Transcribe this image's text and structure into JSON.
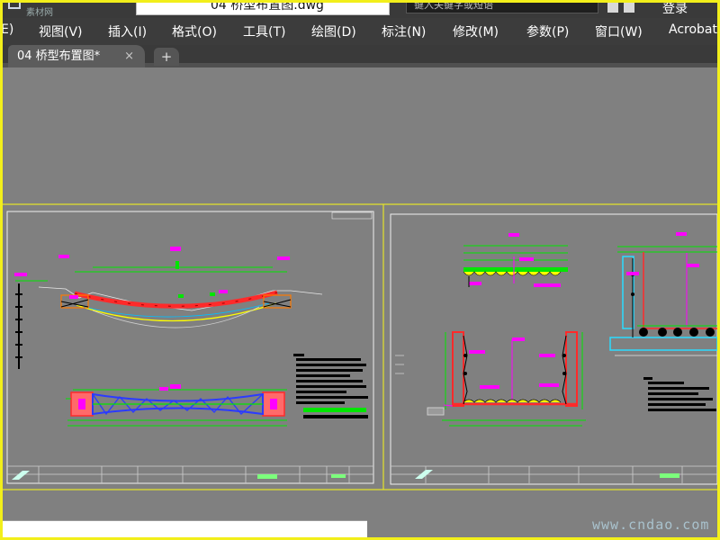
{
  "app": {
    "title_watermark": "素材网",
    "doc_title": "04 桥型布置图.dwg",
    "search_placeholder": "键入关键字或短语",
    "login_label": "登录"
  },
  "menu": {
    "items": [
      "E)",
      "视图(V)",
      "插入(I)",
      "格式(O)",
      "工具(T)",
      "绘图(D)",
      "标注(N)",
      "修改(M)",
      "参数(P)",
      "窗口(W)",
      "Acrobat"
    ]
  },
  "tabs": {
    "active_label": "04 桥型布置图*",
    "close_glyph": "×",
    "new_tab_glyph": "+"
  },
  "watermark": "www.cndao.com",
  "colors": {
    "frame_border": "#f2ef1a",
    "workspace_bg": "#808080",
    "viewport_border": "#e4e22a",
    "magenta": "#ff00ff",
    "green": "#00e600",
    "red": "#ff2a2a",
    "blue": "#2b3bff"
  }
}
